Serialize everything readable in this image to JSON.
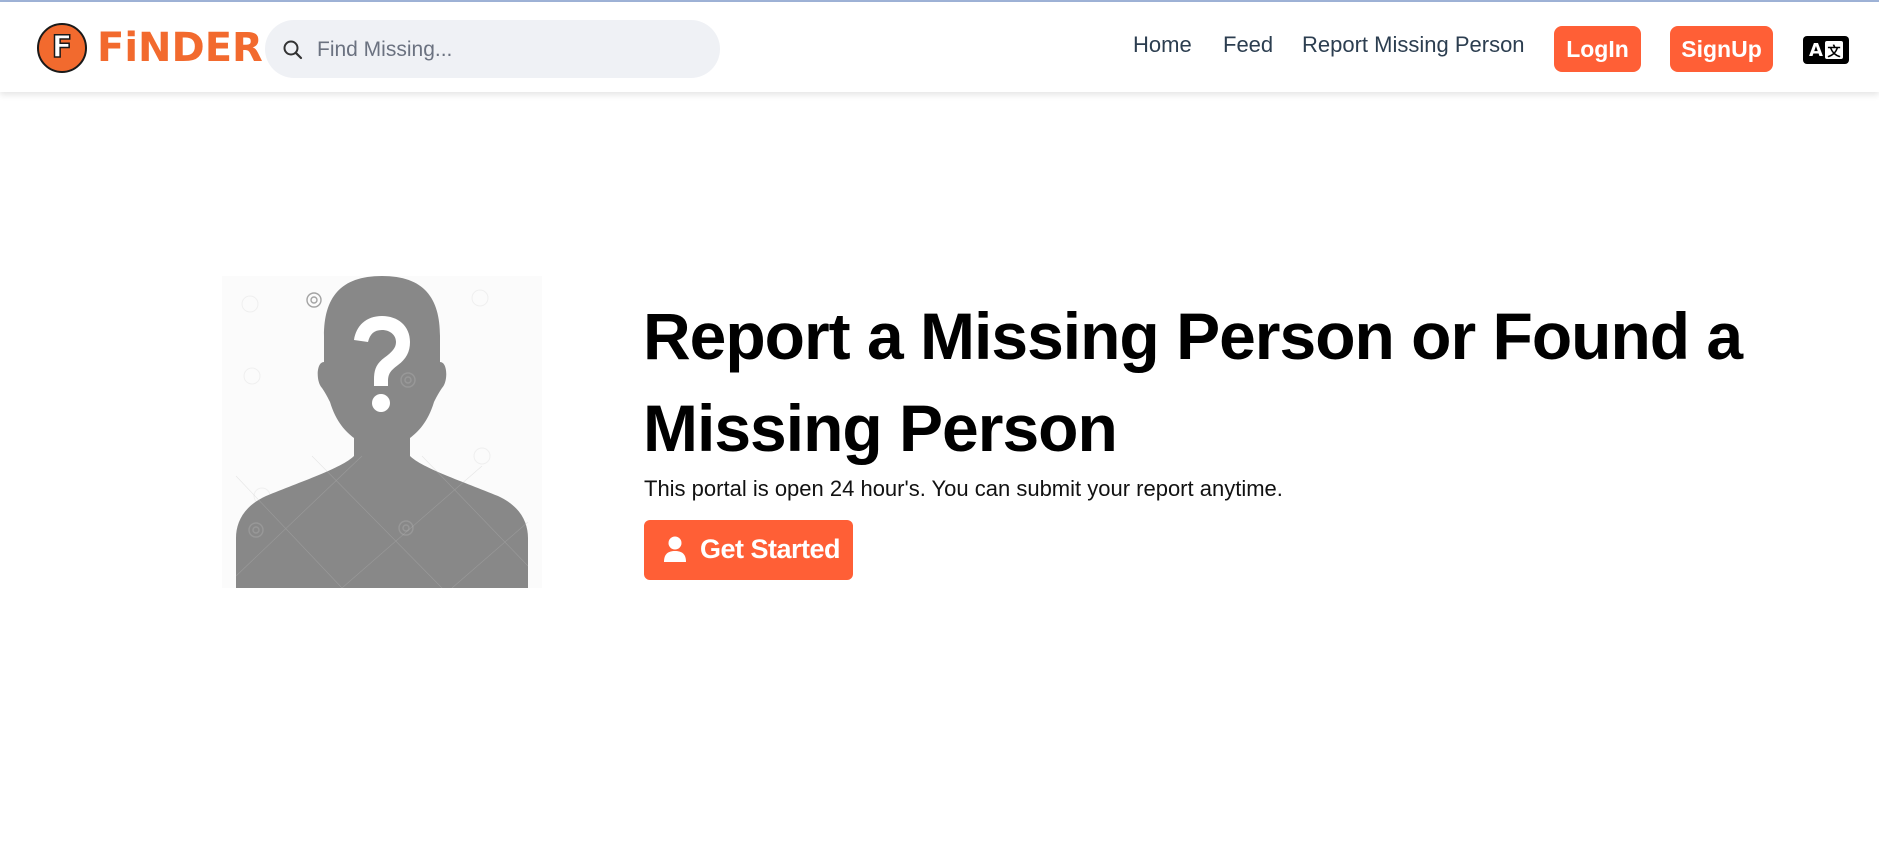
{
  "header": {
    "brand": {
      "letter": "F",
      "name": "FiNDER",
      "color": "#f26a2e"
    },
    "search": {
      "placeholder": "Find Missing...",
      "value": ""
    },
    "nav": {
      "home": "Home",
      "feed": "Feed",
      "report": "Report Missing Person"
    },
    "buttons": {
      "login": "LogIn",
      "signup": "SignUp"
    },
    "language_toggle": {
      "icon": "translate-icon",
      "latin": "A",
      "cjk": "文"
    }
  },
  "hero": {
    "image_icon": "missing-person-silhouette",
    "title": "Report a Missing Person or Found a Missing Person",
    "subtitle": "This portal is open 24 hour's. You can submit your report anytime.",
    "cta_label": "Get Started",
    "cta_icon": "user-icon"
  },
  "colors": {
    "accent": "#ff5f36",
    "nav_text": "#2c3e50",
    "search_bg": "#eff1f5",
    "silhouette": "#888888"
  }
}
